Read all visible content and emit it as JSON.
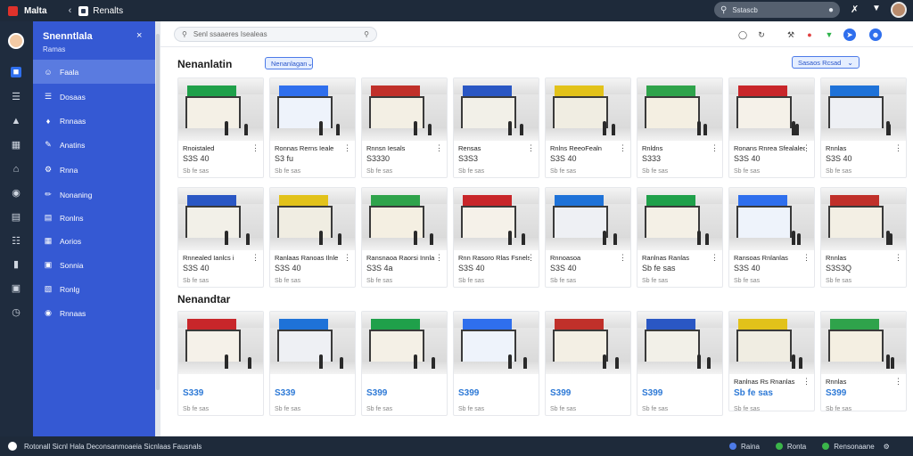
{
  "topbar": {
    "app_name": "Malta",
    "back": "‹",
    "tab_label": "Renalts",
    "search_placeholder": "Sstascb",
    "search_icon": "search-icon",
    "tools_icon": "tools-icon",
    "bell_icon": "bell-icon"
  },
  "sidebar": {
    "title": "Snenntlala",
    "close": "×",
    "subtitle": "Ramas",
    "items": [
      {
        "label": "Faala",
        "icon": "people-icon"
      },
      {
        "label": "Dosaas",
        "icon": "list-icon"
      },
      {
        "label": "Rnnaas",
        "icon": "tag-icon"
      },
      {
        "label": "Anatins",
        "icon": "edit-icon"
      },
      {
        "label": "Rnna",
        "icon": "gear-icon"
      },
      {
        "label": "Nonaning",
        "icon": "pen-icon"
      },
      {
        "label": "Ronlns",
        "icon": "document-icon"
      },
      {
        "label": "Aorios",
        "icon": "grid-icon"
      },
      {
        "label": "Sonnia",
        "icon": "bookmark-icon"
      },
      {
        "label": "Ronlg",
        "icon": "doc-icon"
      },
      {
        "label": "Rnnaas",
        "icon": "settings-icon"
      }
    ]
  },
  "main": {
    "search_placeholder": "Senl ssaaeres Isealeas",
    "section1": {
      "title": "Nenanlatin",
      "filter": "Nenanlagan",
      "sort": "Sasaos Rcsad"
    },
    "section2": {
      "title": "Nenandtar"
    },
    "row1": [
      {
        "name": "Rnoistaled",
        "price": "S3S 40",
        "meta": "Sb fe sas"
      },
      {
        "name": "Ronnas Rerns Ieale",
        "price": "S3 fu",
        "meta": "Sb fe sas"
      },
      {
        "name": "Rnnsn Iesals",
        "price": "S3330",
        "meta": "Sb fe sas"
      },
      {
        "name": "Rensas",
        "price": "S3S3",
        "meta": "Sb fe sas"
      },
      {
        "name": "Rnlns ReeoFealn",
        "price": "S3S 40",
        "meta": "Sb fe sas"
      },
      {
        "name": "Rnldns",
        "price": "S333",
        "meta": "Sb fe sas"
      },
      {
        "name": "Ronans Rnrea Sfealaled",
        "price": "S3S 40",
        "meta": "Sb fe sas"
      },
      {
        "name": "Rnnlas",
        "price": "S3S 40",
        "meta": "Sb fe sas"
      }
    ],
    "row2": [
      {
        "name": "Rnnealed Ianlcs i",
        "price": "S3S 40",
        "meta": "Sb fe sas"
      },
      {
        "name": "Ranlaas Ranoas Ilnle",
        "price": "S3S 40",
        "meta": "Sb fe sas"
      },
      {
        "name": "Ransnaoa Raorsi Innla",
        "price": "S3S 4a",
        "meta": "Sb fe sas"
      },
      {
        "name": "Rnn Rasoro Rlas Fsnels",
        "price": "S3S 40",
        "meta": "Sb fe sas"
      },
      {
        "name": "Rnnoasoa",
        "price": "S3S 40",
        "meta": "Sb fe sas"
      },
      {
        "name": "Ranlnas Ranlas",
        "price": "Sb fe sas",
        "meta": "Sb fe sas"
      },
      {
        "name": "Ransoas Rnlanlas",
        "price": "S3S 40",
        "meta": "Sb fe sas"
      },
      {
        "name": "Rnnlas",
        "price": "S3S3Q",
        "meta": "Sb fe sas"
      }
    ],
    "row3": [
      {
        "price": "S339",
        "meta": "Sb fe sas"
      },
      {
        "price": "S339",
        "meta": "Sb fe sas"
      },
      {
        "price": "S399",
        "meta": "Sb fe sas"
      },
      {
        "price": "S399",
        "meta": "Sb fe sas"
      },
      {
        "price": "S399",
        "meta": "Sb fe sas"
      },
      {
        "price": "S399",
        "meta": "Sb fe sas"
      },
      {
        "name": "Ranlnas Rs Rnanlas",
        "price": "Sb fe sas",
        "meta": "Sb fe sas"
      },
      {
        "name": "Rnnlas",
        "price": "S399",
        "meta": "Sb fe sas"
      }
    ]
  },
  "statusbar": {
    "left": "Rotonall Sicnl Hala Deconsanmoaeia Sicnlaas Fausnals",
    "right1": "Raina",
    "right2": "Ronta",
    "right3": "Rensonaane"
  },
  "colors": {
    "accent": "#3559d3",
    "topbar": "#1e2a3a",
    "price_blue": "#2d79d6"
  }
}
